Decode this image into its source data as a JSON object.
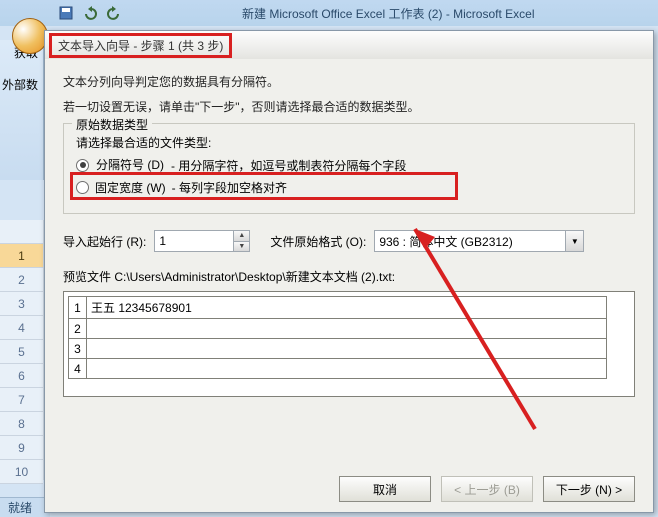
{
  "excel": {
    "title": "新建 Microsoft Office Excel 工作表 (2) - Microsoft Excel",
    "ribbon_group": "获取",
    "ribbon_group2": "外部数",
    "statusbar": "就绪",
    "rowheads": [
      "",
      "1",
      "2",
      "3",
      "4",
      "5",
      "6",
      "7",
      "8",
      "9",
      "10"
    ]
  },
  "dialog": {
    "title": "文本导入向导 - 步骤 1 (共 3 步)",
    "intro1": "文本分列向导判定您的数据具有分隔符。",
    "intro2": "若一切设置无误，请单击\"下一步\"，否则请选择最合适的数据类型。",
    "group_title": "原始数据类型",
    "choose_label": "请选择最合适的文件类型:",
    "radio1": {
      "label": "分隔符号 (D)",
      "desc": "- 用分隔字符，如逗号或制表符分隔每个字段"
    },
    "radio2": {
      "label": "固定宽度 (W)",
      "desc": "- 每列字段加空格对齐"
    },
    "start_row_label": "导入起始行 (R):",
    "start_row_value": "1",
    "origin_label": "文件原始格式 (O):",
    "origin_value": "936 : 简体中文 (GB2312)",
    "preview_label": "预览文件 C:\\Users\\Administrator\\Desktop\\新建文本文档 (2).txt:",
    "preview_rows": [
      "王五 12345678901",
      "",
      "",
      ""
    ],
    "buttons": {
      "cancel": "取消",
      "back": "< 上一步 (B)",
      "next": "下一步 (N) >"
    }
  }
}
